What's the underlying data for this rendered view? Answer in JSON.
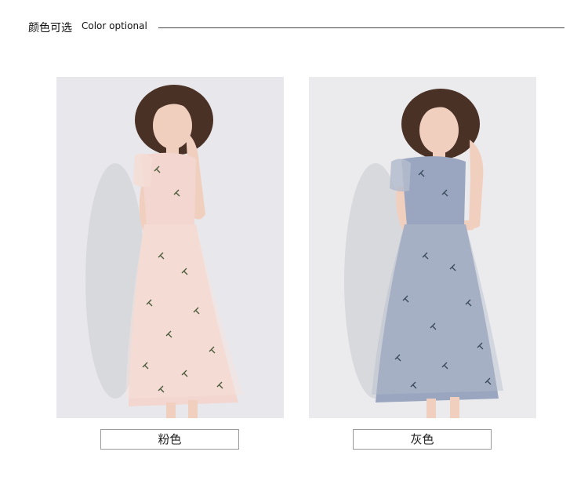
{
  "header": {
    "title_cn": "颜色可选",
    "title_en": "Color optional"
  },
  "variants": [
    {
      "label": "粉色",
      "dress_color": "#f2d6cf",
      "accent": "#4a5a3a"
    },
    {
      "label": "灰色",
      "dress_color": "#9aa6bf",
      "accent": "#3b4a5a"
    }
  ],
  "colors": {
    "background": "#ffffff",
    "photo_backdrop": "#e8e9ec",
    "skin": "#f1cfbf",
    "hair": "#4a3126"
  }
}
